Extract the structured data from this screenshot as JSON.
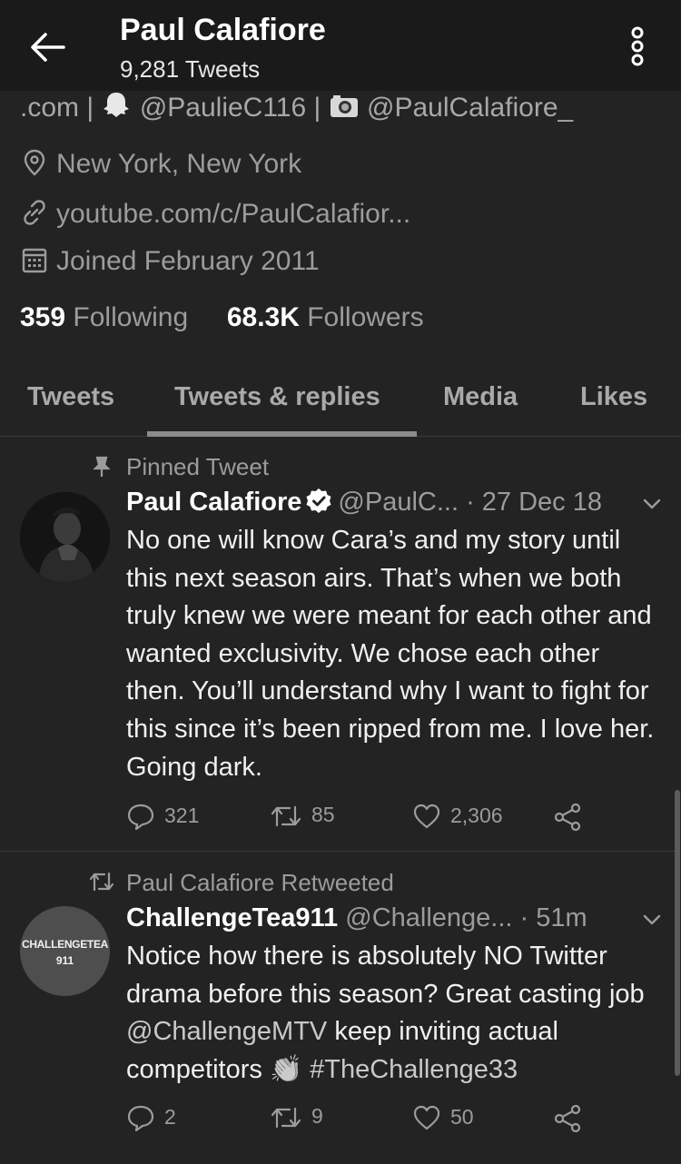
{
  "header": {
    "title": "Paul Calafiore",
    "tweet_count": "9,281 Tweets"
  },
  "profile": {
    "bio_prefix": ".com | ",
    "snapchat_handle": "@PaulieC116",
    "separator": " | ",
    "instagram_handle": "@PaulCalafiore_",
    "location": "New York, New York",
    "website": "youtube.com/c/PaulCalafior...",
    "joined": "Joined February 2011",
    "following_count": "359",
    "following_label": "Following",
    "followers_count": "68.3K",
    "followers_label": "Followers"
  },
  "tabs": [
    {
      "label": "Tweets"
    },
    {
      "label": "Tweets & replies",
      "active": true
    },
    {
      "label": "Media"
    },
    {
      "label": "Likes"
    }
  ],
  "tweets": [
    {
      "context": "Pinned Tweet",
      "name": "Paul Calafiore",
      "handle": "@PaulC...",
      "time": "· 27 Dec 18",
      "text": "No one will know Cara’s and my story until this next season airs. That’s when we both truly knew we were meant for each other and wanted exclusivity. We chose each other then. You’ll understand why I want to fight for this since it’s been ripped from me. I love her. Going dark.",
      "replies": "321",
      "retweets": "85",
      "likes": "2,306"
    },
    {
      "context": "Paul Calafiore Retweeted",
      "name": "ChallengeTea911",
      "handle": "@Challenge...",
      "time": "· 51m",
      "text_before": "Notice how there is absolutely NO Twitter drama before this season? Great casting job ",
      "mention": "@ChallengeMTV",
      "text_middle": " keep inviting actual competitors ",
      "emoji": "👏",
      "hashtag": "#TheChallenge33",
      "avatar_text_1": "CHALLENGETEA",
      "avatar_text_2": "911",
      "replies": "2",
      "retweets": "9",
      "likes": "50"
    }
  ],
  "colors": {
    "background": "#232323",
    "header_background": "#1a1a1a",
    "secondary_text": "#9c9c9c",
    "divider": "#3a3a3a"
  },
  "icons": {
    "back": "arrow-left-icon",
    "more": "more-vertical-icon",
    "location": "location-pin-icon",
    "link": "link-icon",
    "calendar": "calendar-icon",
    "pin": "pin-icon",
    "retweeted": "retweet-icon",
    "verified": "verified-badge-icon"
  }
}
